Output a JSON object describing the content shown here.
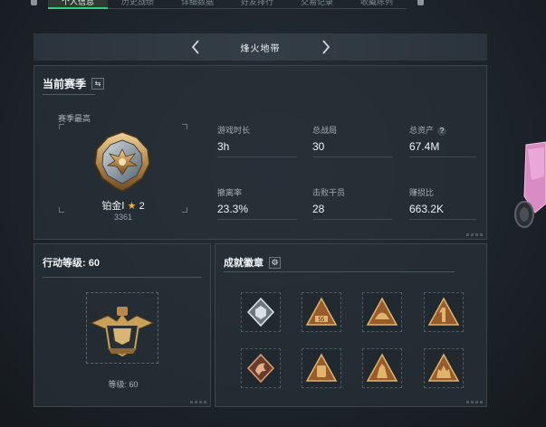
{
  "top_tabs": [
    "个人信息",
    "历史战绩",
    "详细数据",
    "好友排行",
    "交易记录",
    "收藏陈列"
  ],
  "header": {
    "title": "烽火地带",
    "prev": "‹",
    "next": "›"
  },
  "season": {
    "title": "当前赛季",
    "swap_icon": "swap-icon",
    "subtitle": "赛季最高",
    "rank": {
      "name": "铂金Ⅰ",
      "star": "★",
      "stars_count": "2",
      "score": "3361"
    },
    "stats": [
      {
        "label": "游戏时长",
        "value": "3h"
      },
      {
        "label": "总战局",
        "value": "30"
      },
      {
        "label": "总资产",
        "value": "67.4M",
        "help": "?"
      },
      {
        "label": "撤离率",
        "value": "23.3%"
      },
      {
        "label": "击败干员",
        "value": "28"
      },
      {
        "label": "赚损比",
        "value": "663.2K"
      }
    ]
  },
  "level": {
    "title": "行动等级: 60",
    "text": "等级: 60"
  },
  "achievements": {
    "title": "成就徽章",
    "settings_icon": "gear-icon",
    "badges": [
      "badge-diamond-icon",
      "badge-55-icon",
      "badge-helmet-icon",
      "badge-number-one-icon",
      "badge-dragon-icon",
      "badge-pack-icon",
      "badge-warrior-icon",
      "badge-soldiers-icon"
    ]
  },
  "colors": {
    "accent": "#2fd07a",
    "gold": "#c9a058",
    "panel": "#283038"
  }
}
